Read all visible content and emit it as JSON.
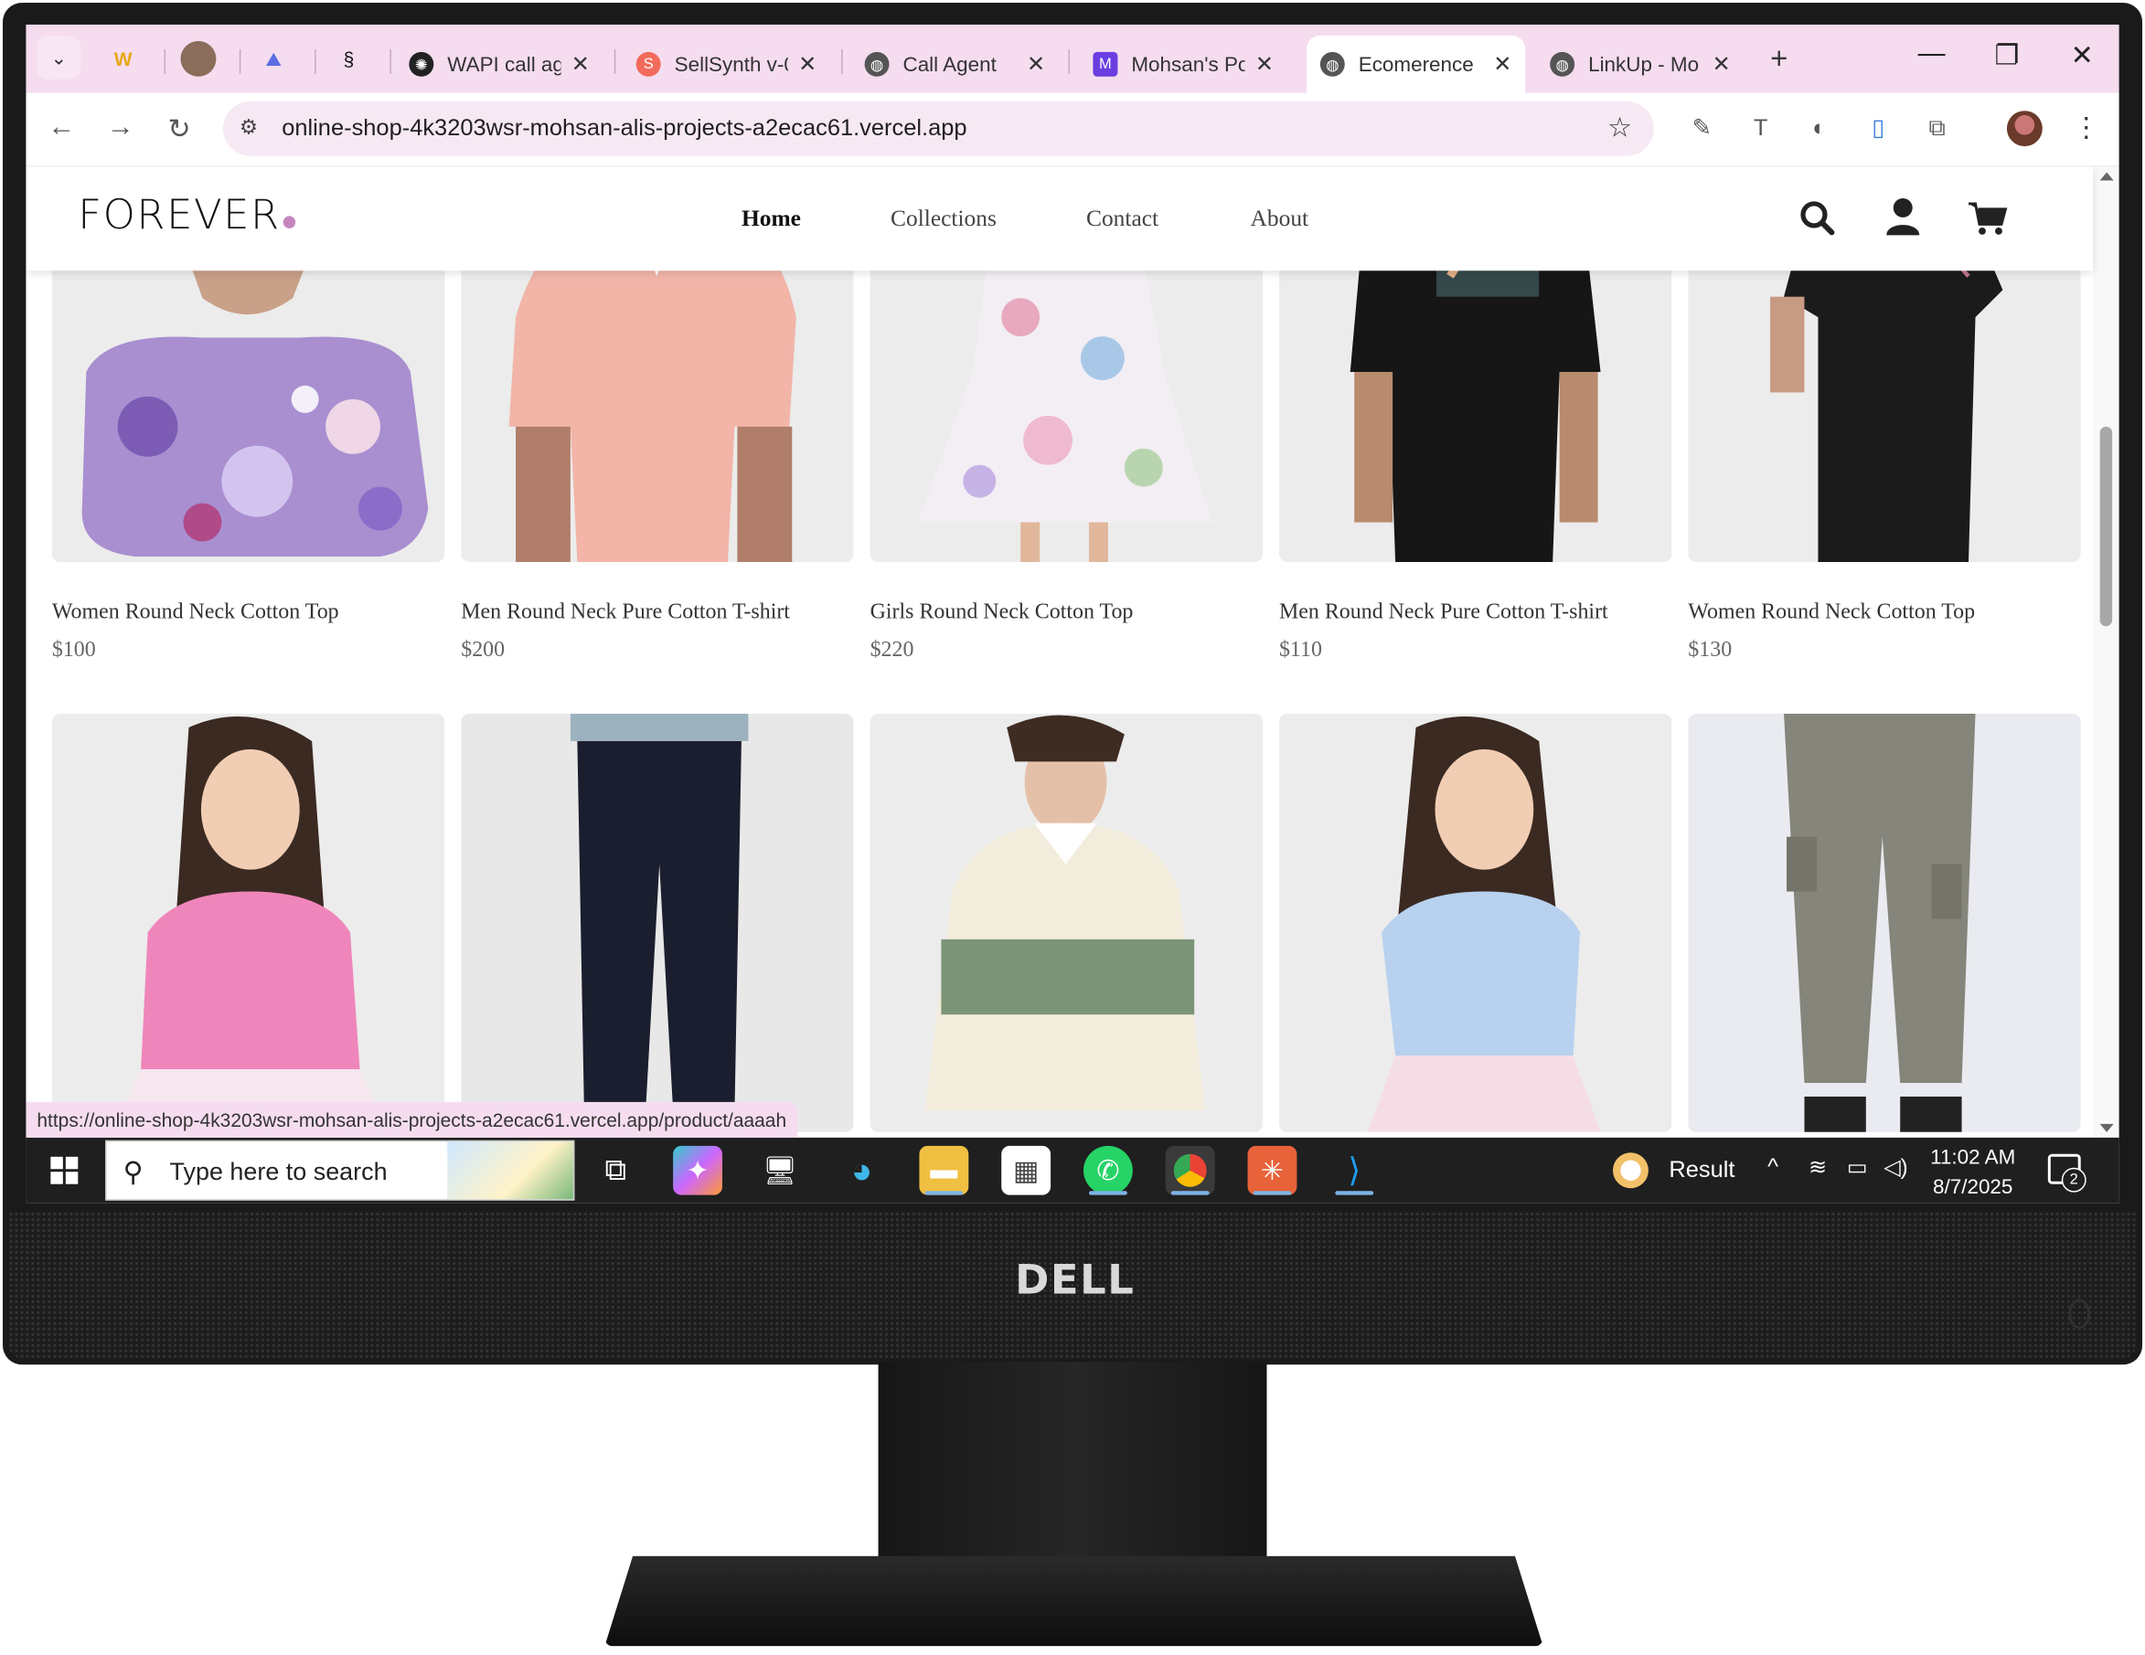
{
  "browser": {
    "tabs": [
      {
        "title": "WAPI call ag",
        "icon": "openai-icon"
      },
      {
        "title": "SellSynth v-0",
        "icon": "sellsynth-icon"
      },
      {
        "title": "Call Agent",
        "icon": "globe-icon"
      },
      {
        "title": "Mohsan's Po",
        "icon": "m-logo-icon"
      },
      {
        "title": "Ecomerence",
        "icon": "globe-icon",
        "active": true
      },
      {
        "title": "LinkUp - Mo",
        "icon": "globe-icon"
      }
    ],
    "url": "online-shop-4k3203wsr-mohsan-alis-projects-a2ecac61.vercel.app",
    "status_url": "https://online-shop-4k3203wsr-mohsan-alis-projects-a2ecac61.vercel.app/product/aaaah"
  },
  "site": {
    "logo": "FOREVER",
    "nav": [
      {
        "label": "Home",
        "active": true
      },
      {
        "label": "Collections"
      },
      {
        "label": "Contact"
      },
      {
        "label": "About"
      }
    ],
    "accent_color": "#c586c0"
  },
  "products": [
    {
      "name": "Women Round Neck Cotton Top",
      "price": "$100",
      "image": "floral-off-shoulder-top"
    },
    {
      "name": "Men Round Neck Pure Cotton T-shirt",
      "price": "$200",
      "image": "pink-polo-shirt"
    },
    {
      "name": "Girls Round Neck Cotton Top",
      "price": "$220",
      "image": "floral-girls-dress"
    },
    {
      "name": "Men Round Neck Pure Cotton T-shirt",
      "price": "$110",
      "image": "black-puma-tshirt"
    },
    {
      "name": "Women Round Neck Cotton Top",
      "price": "$130",
      "image": "black-puma-women-tshirt"
    },
    {
      "name": "",
      "price": "",
      "image": "girl-pink-top"
    },
    {
      "name": "",
      "price": "",
      "image": "navy-jeans"
    },
    {
      "name": "",
      "price": "",
      "image": "striped-rugby-sweatshirt"
    },
    {
      "name": "",
      "price": "",
      "image": "girl-blue-top"
    },
    {
      "name": "",
      "price": "",
      "image": "olive-cargo-joggers"
    }
  ],
  "taskbar": {
    "search_placeholder": "Type here to search",
    "weather_label": "Result",
    "time": "11:02 AM",
    "date": "8/7/2025",
    "notification_count": "2"
  },
  "monitor_brand": "DELL"
}
